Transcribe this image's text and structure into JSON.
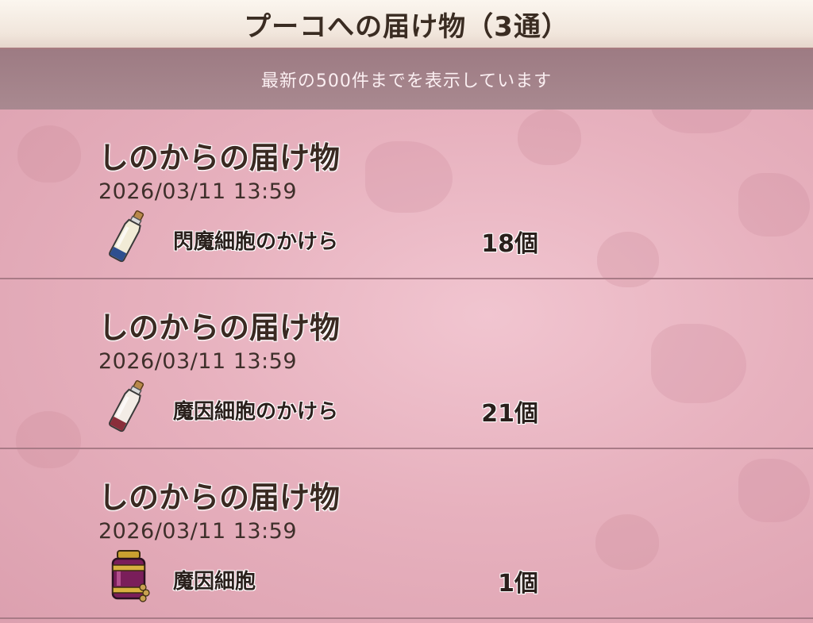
{
  "header": {
    "title": "プーコへの届け物（3通）"
  },
  "notice": {
    "text": "最新の500件までを表示しています"
  },
  "mails": [
    {
      "sender": "しのからの届け物",
      "date": "2026/03/11  13:59",
      "item": "閃魔細胞のかけら",
      "count": "18個",
      "icon": "vial-blue-icon"
    },
    {
      "sender": "しのからの届け物",
      "date": "2026/03/11  13:59",
      "item": "魔因細胞のかけら",
      "count": "21個",
      "icon": "vial-red-icon"
    },
    {
      "sender": "しのからの届け物",
      "date": "2026/03/11  13:59",
      "item": "魔因細胞",
      "count": "1個",
      "icon": "cell-jar-icon"
    }
  ],
  "colors": {
    "header_bg": "#f5ece4",
    "notice_bg": "#a3828a",
    "list_bg": "#e7b1be",
    "divider": "#a97b87",
    "text_dark": "#3a2a22"
  }
}
